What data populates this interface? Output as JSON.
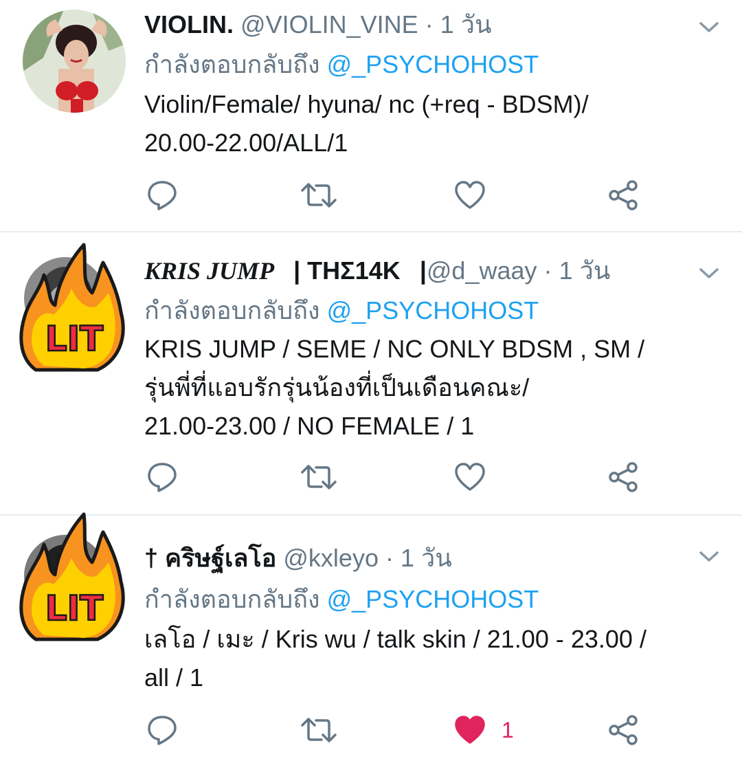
{
  "tweets": [
    {
      "name": "VIOLIN.",
      "handle": "@VIOLIN_VINE",
      "dot": "·",
      "time": "1 วัน",
      "reply_prefix": "กำลังตอบกลับถึง",
      "reply_mention": "@_PSYCHOHOST",
      "body_line1": "Violin/Female/ hyuna/ nc (+req - BDSM)/",
      "body_line2": "20.00-22.00/ALL/1",
      "like_count": "",
      "liked": false
    },
    {
      "name": "KRIS JUMP",
      "name_suffix": "| THΣ14K",
      "name_sep": "|",
      "handle": "@d_waay",
      "dot": "·",
      "time": "1 วัน",
      "avatar_sticker": "LIT",
      "reply_prefix": "กำลังตอบกลับถึง",
      "reply_mention": "@_PSYCHOHOST",
      "body_line1": "KRIS JUMP / SEME / NC ONLY BDSM , SM /",
      "body_line2": "รุ่นพี่ที่แอบรักรุ่นน้องที่เป็นเดือนคณะ/",
      "body_line3": "21.00-23.00 / NO FEMALE / 1",
      "like_count": "",
      "liked": false
    },
    {
      "name": "† คริษฐ์เลโอ",
      "handle": "@kxleyo",
      "dot": "·",
      "time": "1 วัน",
      "avatar_sticker": "LIT",
      "reply_prefix": "กำลังตอบกลับถึง",
      "reply_mention": "@_PSYCHOHOST",
      "body_line1": "เลโอ / เมะ / Kris wu / talk skin / 21.00 - 23.00 /",
      "body_line2": "all / 1",
      "like_count": "1",
      "liked": true
    }
  ],
  "icons": [
    "reply-icon",
    "retweet-icon",
    "like-icon",
    "share-icon",
    "chevron-down-icon"
  ],
  "colors": {
    "link": "#1da1f2",
    "muted": "#657786",
    "like": "#e0245e",
    "divider": "#e6ecf0"
  }
}
